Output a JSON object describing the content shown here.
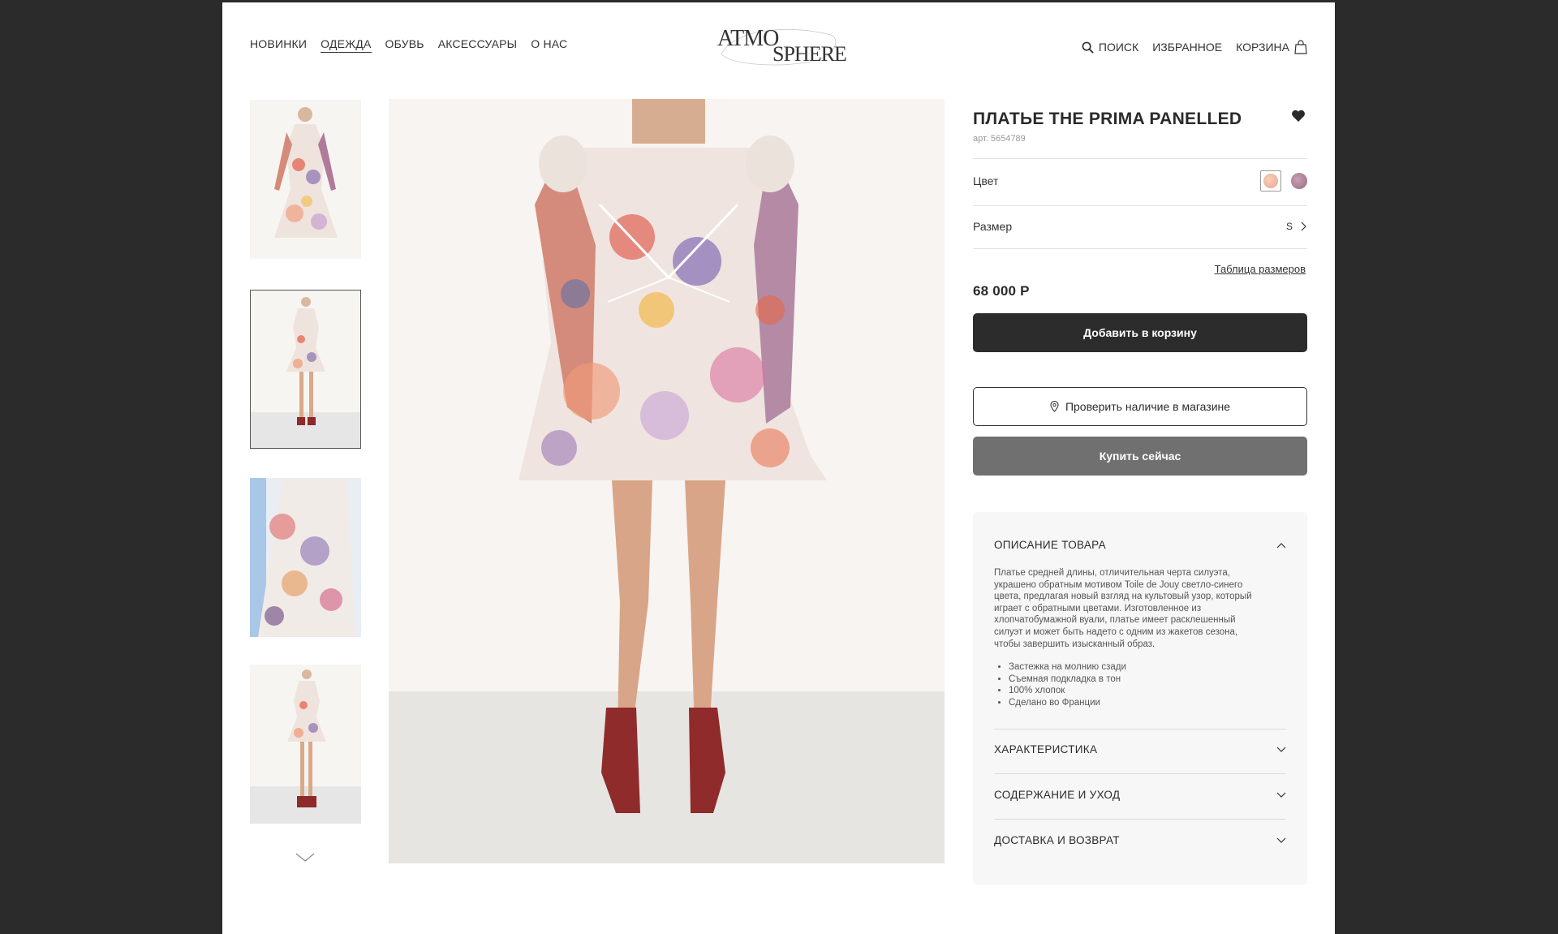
{
  "nav": {
    "items": [
      "НОВИНКИ",
      "ОДЕЖДА",
      "ОБУВЬ",
      "АКСЕССУАРЫ",
      "О НАС"
    ],
    "active": "ОДЕЖДА"
  },
  "logo": {
    "text_left": "ATMO",
    "text_right": "SPHERE"
  },
  "header": {
    "search": "ПОИСК",
    "favorites": "ИЗБРАННОЕ",
    "cart": "КОРЗИНА"
  },
  "product": {
    "title": "ПЛАТЬЕ THE PRIMA PANELLED",
    "sku": "арт. 5654789",
    "color_label": "Цвет",
    "size_label": "Размер",
    "size_value": "S",
    "size_table": "Таблица размеров",
    "price": "68 000 Р",
    "add_to_cart": "Добавить в корзину",
    "check_store": "Проверить наличие в магазине",
    "buy_now": "Купить сейчас",
    "swatches": [
      "#e8a58a",
      "#9a6a7e"
    ]
  },
  "accordion": {
    "description_title": "ОПИСАНИЕ ТОВАРА",
    "description_lines": [
      "Платье средней длины, отличительная черта силуэта,",
      "украшено обратным мотивом Toile de Jouy светло-синего",
      "цвета, предлагая новый взгляд на культовый узор, который",
      "играет с обратными цветами. Изготовленное из",
      "хлопчатобумажной вуали, платье имеет расклешенный",
      "силуэт и может быть надето с одним из жакетов сезона,",
      "чтобы завершить изысканный образ."
    ],
    "bullets": [
      "Застежка на молнию сзади",
      "Съемная подкладка в тон",
      "100% хлопок",
      "Сделано во Франции"
    ],
    "sections": [
      "ХАРАКТЕРИСТИКА",
      "СОДЕРЖАНИЕ И УХОД",
      "ДОСТАВКА И ВОЗВРАТ"
    ]
  },
  "icons": {
    "search": "search-icon",
    "cart": "bag-icon",
    "favorite": "heart-icon",
    "location": "map-pin-icon"
  }
}
